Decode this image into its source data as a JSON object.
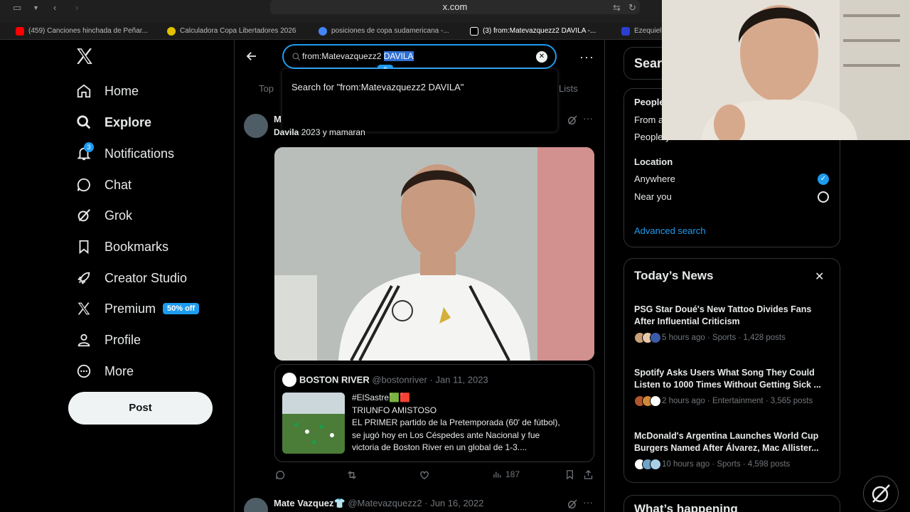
{
  "browser": {
    "url": "x.com",
    "tabs": [
      {
        "label": "(459) Canciones hinchada de Peñar...",
        "color": "#ff0000"
      },
      {
        "label": "Calculadora Copa Libertadores 2026",
        "color": "#e0c000"
      },
      {
        "label": "posiciones de copa sudamericana -...",
        "color": "#4285f4"
      },
      {
        "label": "(3) from:Matevazquezz2 DAVILA -...",
        "color": "#ffffff"
      },
      {
        "label": "Ezequiel",
        "color": "#2a3fd0"
      }
    ]
  },
  "nav": {
    "items": [
      {
        "label": "Home",
        "icon": "home-icon"
      },
      {
        "label": "Explore",
        "icon": "search-icon"
      },
      {
        "label": "Notifications",
        "icon": "bell-icon",
        "badge": "3"
      },
      {
        "label": "Chat",
        "icon": "chat-icon"
      },
      {
        "label": "Grok",
        "icon": "grok-icon"
      },
      {
        "label": "Bookmarks",
        "icon": "bookmark-icon"
      },
      {
        "label": "Creator Studio",
        "icon": "rocket-icon"
      },
      {
        "label": "Premium",
        "icon": "x-icon",
        "promo": "50% off"
      },
      {
        "label": "Profile",
        "icon": "person-icon"
      },
      {
        "label": "More",
        "icon": "more-circle-icon"
      }
    ],
    "post_label": "Post"
  },
  "search": {
    "value_plain": "from:Matevazquezz2 ",
    "value_selected": "DAVILA",
    "suggestion": "Search for \"from:Matevazquezz2 DAVILA\""
  },
  "tabs": {
    "top": "Top",
    "lists": "Lists"
  },
  "tweet1": {
    "author_initial": "M",
    "text_bold": "Davila",
    "text_rest": " 2023 y mamaran",
    "quote": {
      "name": "BOSTON RIVER",
      "handle": "@bostonriver",
      "date": "Jan 11, 2023",
      "lines": [
        "#ElSastre🟩🟥",
        "TRIUNFO AMISTOSO",
        "EL PRIMER partido de la Pretemporada (60' de fútbol),",
        "se jugó hoy en Los Céspedes ante Nacional y fue",
        "victoria de Boston River en un global de 1-3...."
      ]
    },
    "views": "187"
  },
  "tweet2": {
    "name": "Mate Vazquez👕",
    "handle": "@Matevazquezz2",
    "date": "Jun 16, 2022"
  },
  "right": {
    "search_title": "Sear",
    "people_label": "People",
    "people_opt1": "From a",
    "people_opt2": "People y",
    "location_label": "Location",
    "location_anywhere": "Anywhere",
    "location_near": "Near you",
    "advanced": "Advanced search",
    "news_title": "Today’s News",
    "news": [
      {
        "headline": "PSG Star Doué's New Tattoo Divides Fans After Influential Criticism",
        "meta": "5 hours ago · Sports · 1,428 posts",
        "faces": [
          "#c9a07a",
          "#e6c9a8",
          "#3b5ba8"
        ]
      },
      {
        "headline": "Spotify Asks Users What Song They Could Listen to 1000 Times Without Getting Sick ...",
        "meta": "2 hours ago · Entertainment · 3,565 posts",
        "faces": [
          "#b0552d",
          "#d08a3a",
          "#ffffff"
        ]
      },
      {
        "headline": "McDonald's Argentina Launches World Cup Burgers Named After Álvarez, Mac Allister...",
        "meta": "10 hours ago · Sports · 4,598 posts",
        "faces": [
          "#ffffff",
          "#6fa3c8",
          "#a9cfe8"
        ]
      }
    ],
    "happening": "What’s happening"
  },
  "colors": {
    "accent": "#1d9bf0",
    "bg": "#000000",
    "border": "#2f3336",
    "muted": "#71767b"
  }
}
